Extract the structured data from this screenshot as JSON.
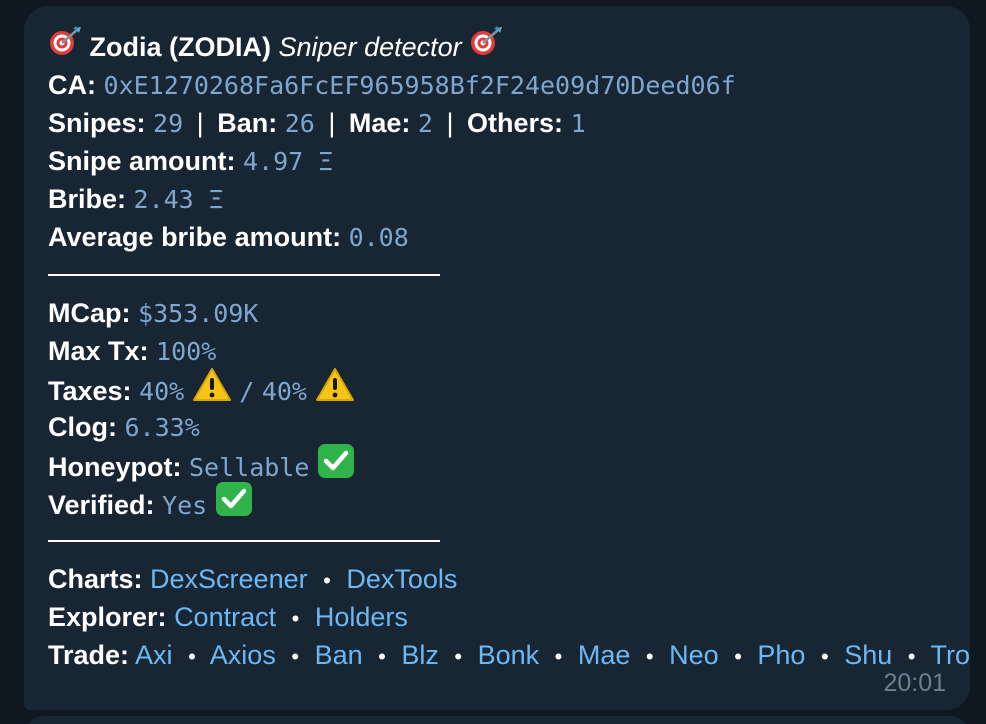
{
  "header": {
    "title": "Zodia (ZODIA)",
    "subtitle": "Sniper detector",
    "icon": "target-dart-icon"
  },
  "ca": {
    "label": "CA:",
    "value": "0xE1270268Fa6FcEF965958Bf2F24e09d70Deed06f"
  },
  "snipes": {
    "snipes_label": "Snipes:",
    "snipes_value": "29",
    "ban_label": "Ban:",
    "ban_value": "26",
    "mae_label": "Mae:",
    "mae_value": "2",
    "others_label": "Others:",
    "others_value": "1",
    "separator": "|"
  },
  "snipe_amount": {
    "label": "Snipe amount:",
    "value": "4.97 Ξ"
  },
  "bribe": {
    "label": "Bribe:",
    "value": "2.43 Ξ"
  },
  "avg_bribe": {
    "label": "Average bribe amount:",
    "value": "0.08"
  },
  "mcap": {
    "label": "MCap:",
    "value": "$353.09K"
  },
  "max_tx": {
    "label": "Max Tx:",
    "value": "100%"
  },
  "taxes": {
    "label": "Taxes:",
    "buy": "40%",
    "slash": "/",
    "sell": "40%",
    "icon": "warning-icon"
  },
  "clog": {
    "label": "Clog:",
    "value": "6.33%"
  },
  "honeypot": {
    "label": "Honeypot:",
    "value": "Sellable",
    "icon": "check-mark-icon"
  },
  "verified": {
    "label": "Verified:",
    "value": "Yes",
    "icon": "check-mark-icon"
  },
  "charts": {
    "label": "Charts:",
    "links": [
      "DexScreener",
      "DexTools"
    ]
  },
  "explorer": {
    "label": "Explorer:",
    "links": [
      "Contract",
      "Holders"
    ]
  },
  "trade": {
    "label": "Trade:",
    "links": [
      "Axi",
      "Axios",
      "Ban",
      "Blz",
      "Bonk",
      "Mae",
      "Neo",
      "Pho",
      "Shu",
      "Tro"
    ]
  },
  "dot_separator": "•",
  "time": "20:01",
  "colors": {
    "background": "#0f1720",
    "bubble": "#182533",
    "link": "#6cb8f5",
    "code": "#7ea6cf",
    "time": "#6d7f8f"
  }
}
